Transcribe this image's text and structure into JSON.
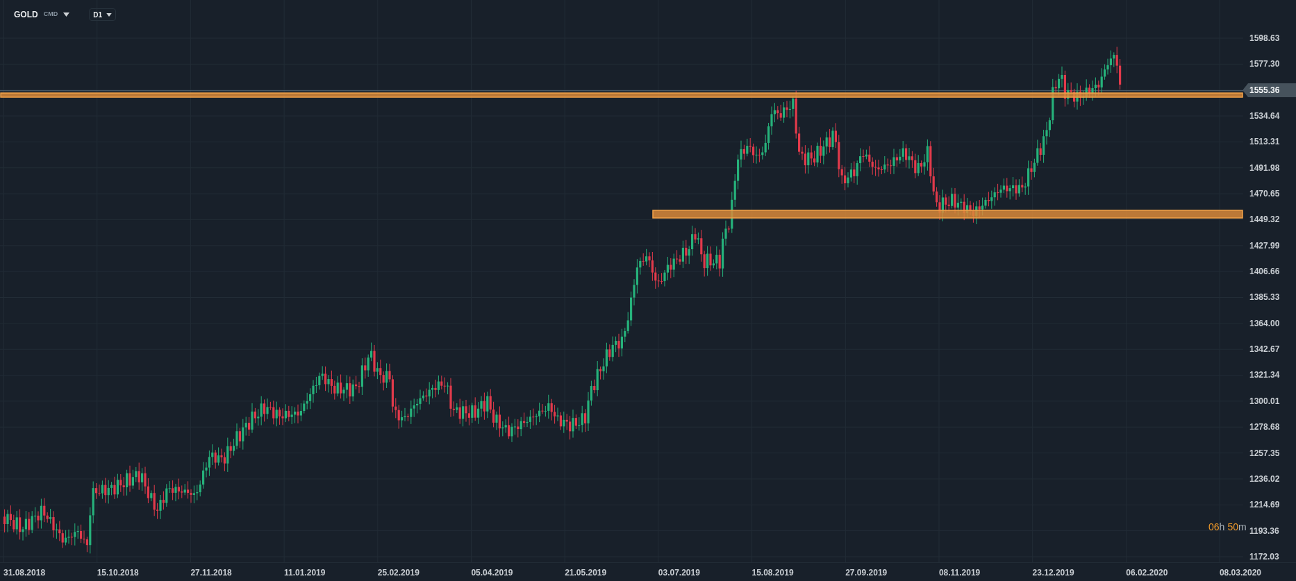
{
  "toolbar": {
    "symbol": "GOLD",
    "market": "CMD",
    "timeframe": "D1"
  },
  "y_axis": {
    "labels": [
      {
        "kind": "tick",
        "text": "1598.63"
      },
      {
        "kind": "tick",
        "text": "1577.30"
      },
      {
        "kind": "price",
        "text": "1555.36"
      },
      {
        "kind": "tick",
        "text": "1534.64"
      },
      {
        "kind": "tick",
        "text": "1513.31"
      },
      {
        "kind": "tick",
        "text": "1491.98"
      },
      {
        "kind": "tick",
        "text": "1470.65"
      },
      {
        "kind": "tick",
        "text": "1449.32"
      },
      {
        "kind": "tick",
        "text": "1427.99"
      },
      {
        "kind": "tick",
        "text": "1406.66"
      },
      {
        "kind": "tick",
        "text": "1385.33"
      },
      {
        "kind": "tick",
        "text": "1364.00"
      },
      {
        "kind": "tick",
        "text": "1342.67"
      },
      {
        "kind": "tick",
        "text": "1321.34"
      },
      {
        "kind": "tick",
        "text": "1300.01"
      },
      {
        "kind": "tick",
        "text": "1278.68"
      },
      {
        "kind": "tick",
        "text": "1257.35"
      },
      {
        "kind": "tick",
        "text": "1236.02"
      },
      {
        "kind": "tick",
        "text": "1214.69"
      },
      {
        "kind": "tick",
        "text": "1193.36"
      },
      {
        "kind": "tick",
        "text": "1172.03"
      }
    ]
  },
  "x_axis": {
    "labels": [
      "31.08.2018",
      "15.10.2018",
      "27.11.2018",
      "11.01.2019",
      "25.02.2019",
      "05.04.2019",
      "21.05.2019",
      "03.07.2019",
      "15.08.2019",
      "27.09.2019",
      "08.11.2019",
      "23.12.2019",
      "06.02.2020",
      "08.03.2020"
    ]
  },
  "countdown": [
    {
      "value": "06",
      "unit": "h"
    },
    {
      "value": "50",
      "unit": "m"
    }
  ]
}
